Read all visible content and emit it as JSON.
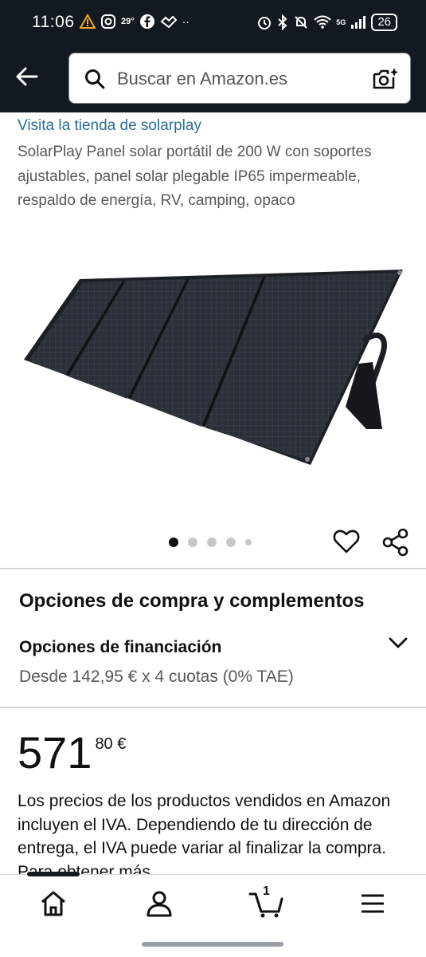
{
  "status_bar": {
    "time": "11:06",
    "temperature": "29°",
    "battery": "26",
    "network": "5G"
  },
  "search": {
    "placeholder": "Buscar en Amazon.es"
  },
  "product": {
    "store_link": "Visita la tienda de solarplay",
    "title": "SolarPlay Panel solar portátil de 200 W con soportes ajustables, panel solar plegable IP65 impermeable, respaldo de energía, RV, camping, opaco",
    "image_count": 5,
    "active_image": 1
  },
  "buying_options": {
    "heading": "Opciones de compra y complementos",
    "financing_title": "Opciones de financiación",
    "financing_detail": "Desde 142,95 € x 4 cuotas (0% TAE)"
  },
  "price": {
    "whole": "571",
    "fraction": "80 €"
  },
  "vat_notice": "Los precios de los productos vendidos en Amazon incluyen el IVA. Dependiendo de tu dirección de entrega, el IVA puede variar al finalizar la compra. Para obtener más",
  "bottom_nav": {
    "cart_count": "1"
  },
  "colors": {
    "header_bg": "#131921",
    "link": "#2a6f97",
    "muted_text": "#565959"
  }
}
